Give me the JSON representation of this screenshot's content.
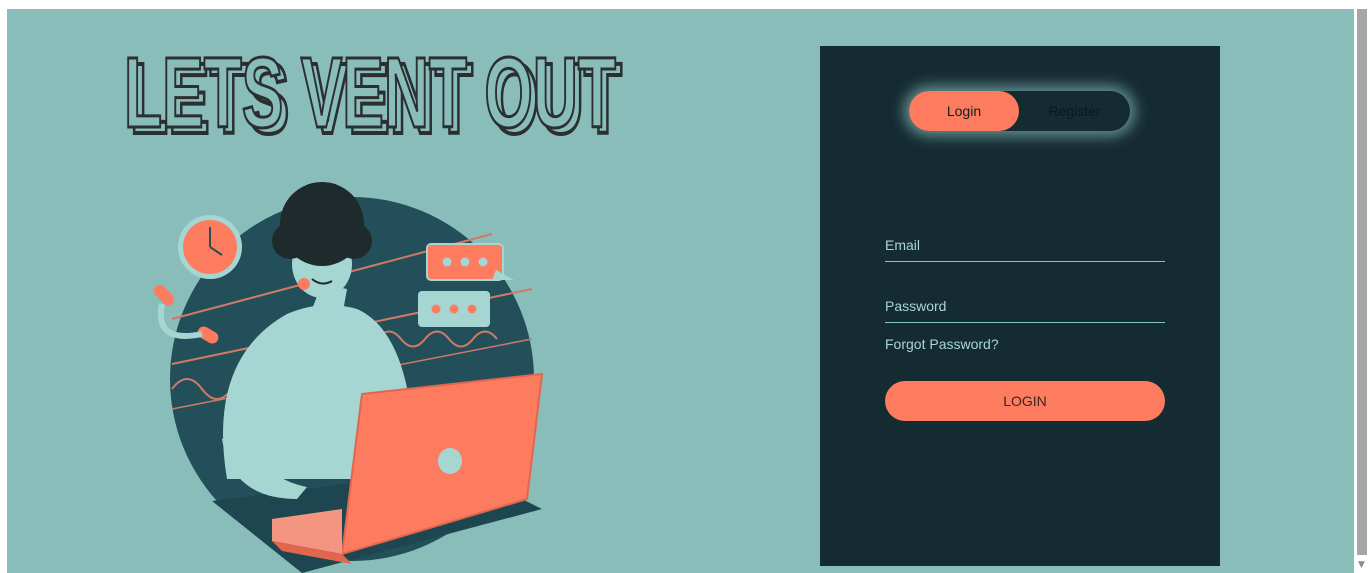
{
  "hero": {
    "title": "LETS VENT OUT"
  },
  "auth": {
    "tabs": {
      "login_label": "Login",
      "register_label": "Register",
      "active": "login"
    },
    "email": {
      "placeholder": "Email",
      "value": ""
    },
    "password": {
      "placeholder": "Password",
      "value": ""
    },
    "forgot_label": "Forgot Password?",
    "submit_label": "LOGIN"
  },
  "colors": {
    "page_bg": "#89bdba",
    "panel_bg": "#142b31",
    "accent": "#fd7b5f",
    "field_text": "#a9d6d2",
    "illustration_dark": "#224f5a",
    "illustration_light": "#a6d6d2"
  },
  "icons": {
    "clock": "clock-icon",
    "chat": "chat-bubble-icon",
    "scroll_down": "chevron-down-icon"
  }
}
